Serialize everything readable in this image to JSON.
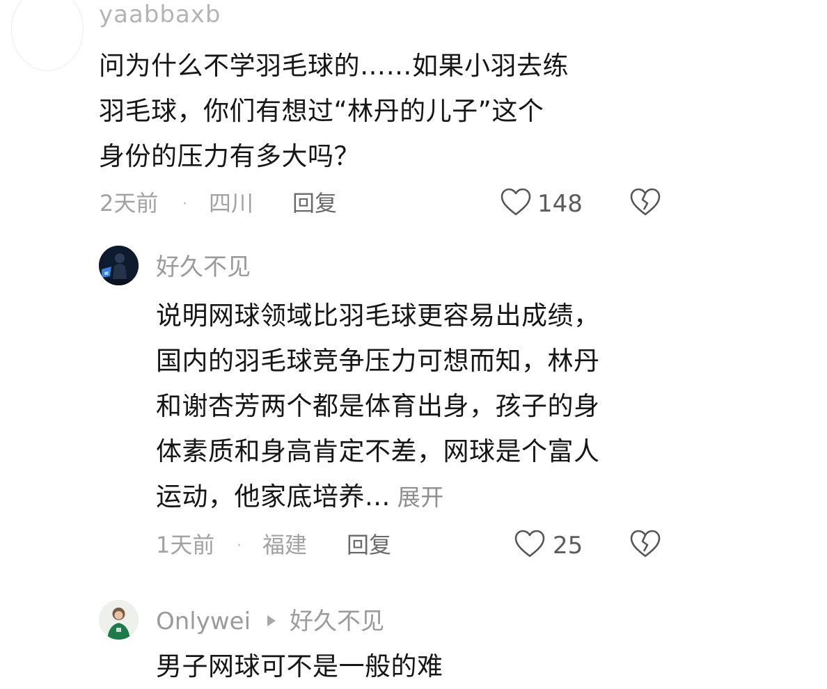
{
  "comments": [
    {
      "username": "yaabbaxb",
      "text_lines": [
        "问为什么不学羽毛球的……如果小羽去练",
        "羽毛球，你们有想过“林丹的儿子”这个",
        "身份的压力有多大吗？"
      ],
      "time": "2天前",
      "separator": "·",
      "location": "四川",
      "reply_label": "回复",
      "likes": "148",
      "like_icon": "heart-outline-icon",
      "dislike_icon": "broken-heart-icon"
    },
    {
      "username": "好久不见",
      "text_lines": [
        "说明网球领域比羽毛球更容易出成绩，",
        "国内的羽毛球竞争压力可想而知，林丹",
        "和谢杏芳两个都是体育出身，孩子的身",
        "体素质和身高肯定不差，网球是个富人",
        "运动，他家底培养..."
      ],
      "expand_label": "展开",
      "time": "1天前",
      "separator": "·",
      "location": "福建",
      "reply_label": "回复",
      "likes": "25",
      "like_icon": "heart-outline-icon",
      "dislike_icon": "broken-heart-icon"
    },
    {
      "username": "Onlywei",
      "reply_to": "好久不见",
      "reply_arrow_icon": "play-triangle-icon",
      "text_lines": [
        "男子网球可不是一般的难"
      ]
    }
  ]
}
